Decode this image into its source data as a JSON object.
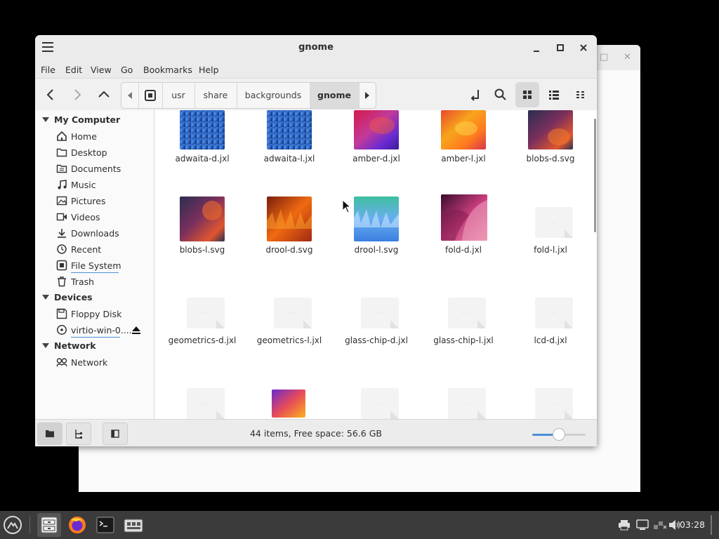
{
  "window": {
    "title": "gnome",
    "menu": [
      "File",
      "Edit",
      "View",
      "Go",
      "Bookmarks",
      "Help"
    ],
    "path": [
      "usr",
      "share",
      "backgrounds",
      "gnome"
    ],
    "status": "44 items, Free space: 56.6 GB",
    "zoom_level": 0.5
  },
  "sidebar": {
    "sections": [
      {
        "title": "My Computer",
        "items": [
          {
            "label": "Home",
            "icon": "home-icon"
          },
          {
            "label": "Desktop",
            "icon": "folder-icon"
          },
          {
            "label": "Documents",
            "icon": "document-icon"
          },
          {
            "label": "Music",
            "icon": "music-icon"
          },
          {
            "label": "Pictures",
            "icon": "picture-icon"
          },
          {
            "label": "Videos",
            "icon": "video-icon"
          },
          {
            "label": "Downloads",
            "icon": "download-icon"
          },
          {
            "label": "Recent",
            "icon": "clock-icon"
          },
          {
            "label": "File System",
            "icon": "drive-icon"
          },
          {
            "label": "Trash",
            "icon": "trash-icon"
          }
        ]
      },
      {
        "title": "Devices",
        "items": [
          {
            "label": "Floppy Disk",
            "icon": "floppy-icon"
          },
          {
            "label": "virtio-win-0....",
            "icon": "optical-disc-icon"
          }
        ]
      },
      {
        "title": "Network",
        "items": [
          {
            "label": "Network",
            "icon": "network-icon"
          }
        ]
      }
    ]
  },
  "files": [
    {
      "name": "adwaita-d.jxl",
      "thumb": "blue-mosaic"
    },
    {
      "name": "adwaita-l.jxl",
      "thumb": "blue-mosaic"
    },
    {
      "name": "amber-d.jxl",
      "thumb": "amber-dark"
    },
    {
      "name": "amber-l.jxl",
      "thumb": "amber-light"
    },
    {
      "name": "blobs-d.svg",
      "thumb": "blobs"
    },
    {
      "name": "blobs-l.svg",
      "thumb": "blobs"
    },
    {
      "name": "drool-d.svg",
      "thumb": "drool-dark"
    },
    {
      "name": "drool-l.svg",
      "thumb": "drool-light"
    },
    {
      "name": "fold-d.jxl",
      "thumb": "fold"
    },
    {
      "name": "fold-l.jxl",
      "thumb": "placeholder"
    },
    {
      "name": "geometrics-d.jxl",
      "thumb": "placeholder"
    },
    {
      "name": "geometrics-l.jxl",
      "thumb": "placeholder"
    },
    {
      "name": "glass-chip-d.jxl",
      "thumb": "placeholder"
    },
    {
      "name": "glass-chip-l.jxl",
      "thumb": "placeholder"
    },
    {
      "name": "lcd-d.jxl",
      "thumb": "placeholder"
    }
  ],
  "taskbar": {
    "apps": [
      "menu-icon",
      "file-manager-icon",
      "firefox-icon",
      "terminal-icon",
      "apps-icon"
    ],
    "clock": "03:28"
  },
  "colors": {
    "accent": "#4a90d9",
    "panel": "#3b3b3b"
  }
}
